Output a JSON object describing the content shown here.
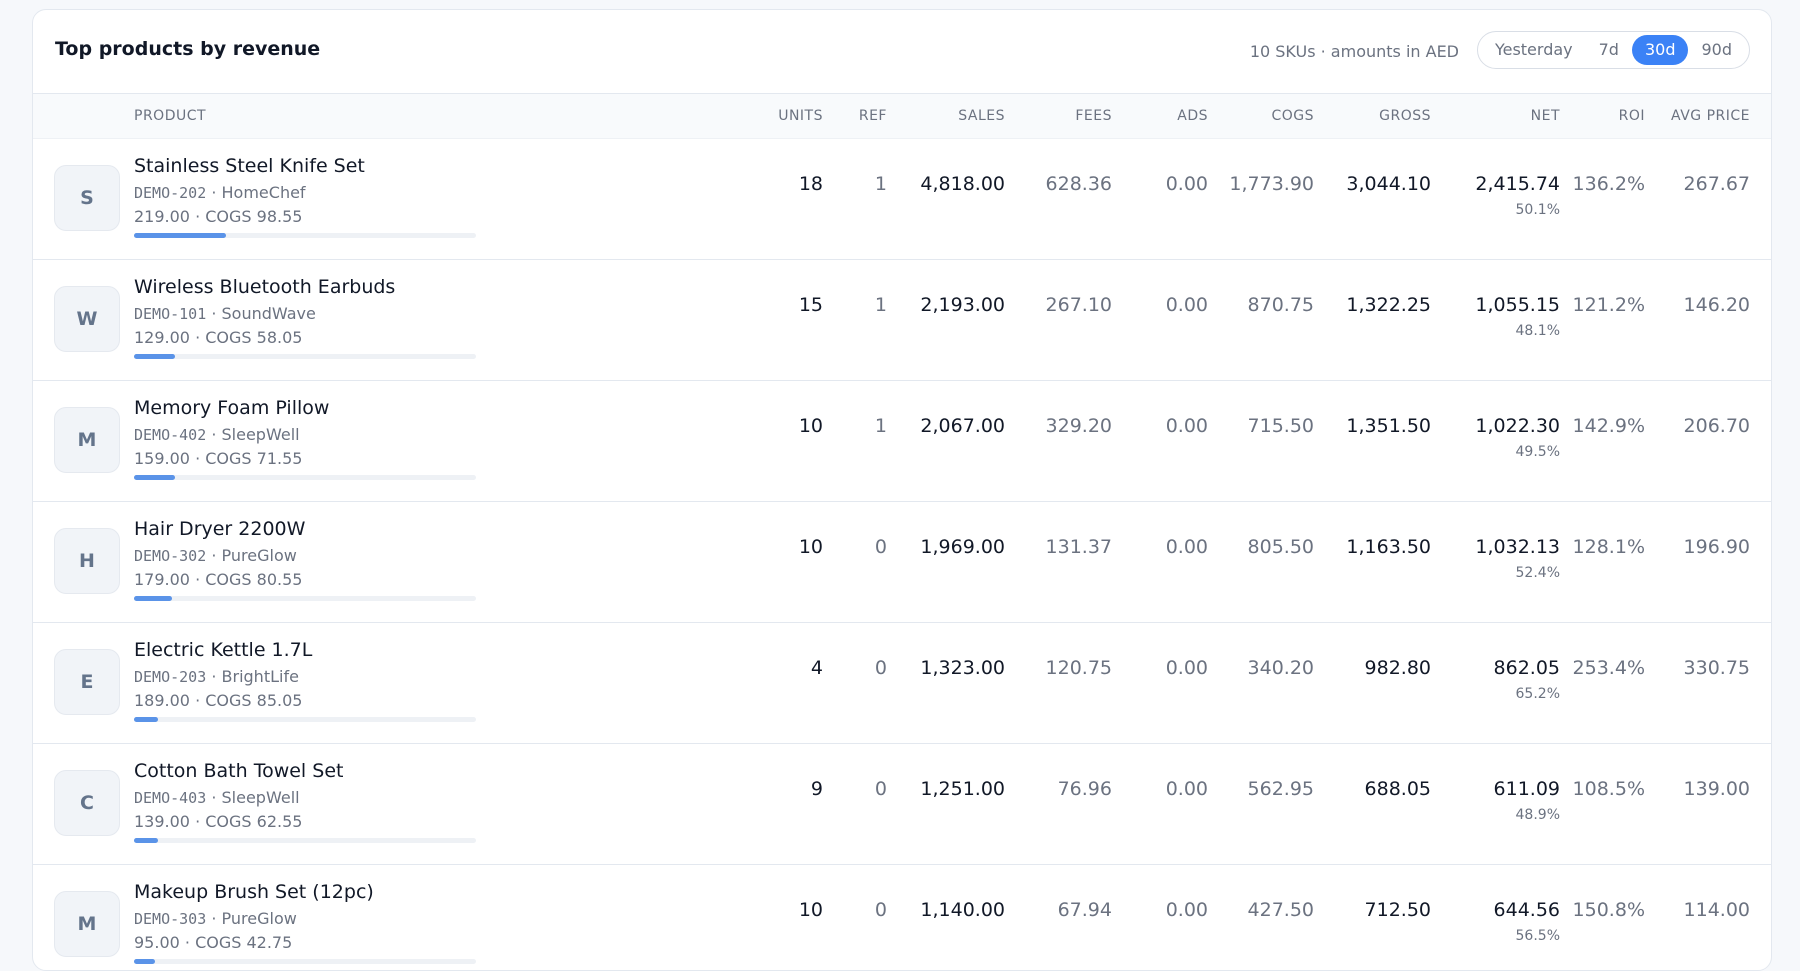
{
  "title": "Top products by revenue",
  "meta": "10 SKUs · amounts in AED",
  "ranges": [
    {
      "label": "Yesterday",
      "active": false
    },
    {
      "label": "7d",
      "active": false
    },
    {
      "label": "30d",
      "active": true
    },
    {
      "label": "90d",
      "active": false
    }
  ],
  "columns": {
    "product": "PRODUCT",
    "units": "UNITS",
    "ref": "REF",
    "sales": "SALES",
    "fees": "FEES",
    "ads": "ADS",
    "cogs": "COGS",
    "gross": "GROSS",
    "net": "NET",
    "roi": "ROI",
    "avg_price": "AVG PRICE"
  },
  "rows": [
    {
      "initial": "S",
      "name": "Stainless Steel Knife Set",
      "sku": "DEMO-202",
      "brand": "HomeChef",
      "price_line": "219.00 · COGS 98.55",
      "share": 0.27,
      "units": "18",
      "ref": "1",
      "sales": "4,818.00",
      "fees": "628.36",
      "ads": "0.00",
      "cogs": "1,773.90",
      "gross": "3,044.10",
      "net": "2,415.74",
      "margin": "50.1%",
      "roi": "136.2%",
      "avg_price": "267.67"
    },
    {
      "initial": "W",
      "name": "Wireless Bluetooth Earbuds",
      "sku": "DEMO-101",
      "brand": "SoundWave",
      "price_line": "129.00 · COGS 58.05",
      "share": 0.12,
      "units": "15",
      "ref": "1",
      "sales": "2,193.00",
      "fees": "267.10",
      "ads": "0.00",
      "cogs": "870.75",
      "gross": "1,322.25",
      "net": "1,055.15",
      "margin": "48.1%",
      "roi": "121.2%",
      "avg_price": "146.20"
    },
    {
      "initial": "M",
      "name": "Memory Foam Pillow",
      "sku": "DEMO-402",
      "brand": "SleepWell",
      "price_line": "159.00 · COGS 71.55",
      "share": 0.12,
      "units": "10",
      "ref": "1",
      "sales": "2,067.00",
      "fees": "329.20",
      "ads": "0.00",
      "cogs": "715.50",
      "gross": "1,351.50",
      "net": "1,022.30",
      "margin": "49.5%",
      "roi": "142.9%",
      "avg_price": "206.70"
    },
    {
      "initial": "H",
      "name": "Hair Dryer 2200W",
      "sku": "DEMO-302",
      "brand": "PureGlow",
      "price_line": "179.00 · COGS 80.55",
      "share": 0.11,
      "units": "10",
      "ref": "0",
      "sales": "1,969.00",
      "fees": "131.37",
      "ads": "0.00",
      "cogs": "805.50",
      "gross": "1,163.50",
      "net": "1,032.13",
      "margin": "52.4%",
      "roi": "128.1%",
      "avg_price": "196.90"
    },
    {
      "initial": "E",
      "name": "Electric Kettle 1.7L",
      "sku": "DEMO-203",
      "brand": "BrightLife",
      "price_line": "189.00 · COGS 85.05",
      "share": 0.07,
      "units": "4",
      "ref": "0",
      "sales": "1,323.00",
      "fees": "120.75",
      "ads": "0.00",
      "cogs": "340.20",
      "gross": "982.80",
      "net": "862.05",
      "margin": "65.2%",
      "roi": "253.4%",
      "avg_price": "330.75"
    },
    {
      "initial": "C",
      "name": "Cotton Bath Towel Set",
      "sku": "DEMO-403",
      "brand": "SleepWell",
      "price_line": "139.00 · COGS 62.55",
      "share": 0.07,
      "units": "9",
      "ref": "0",
      "sales": "1,251.00",
      "fees": "76.96",
      "ads": "0.00",
      "cogs": "562.95",
      "gross": "688.05",
      "net": "611.09",
      "margin": "48.9%",
      "roi": "108.5%",
      "avg_price": "139.00"
    },
    {
      "initial": "M",
      "name": "Makeup Brush Set (12pc)",
      "sku": "DEMO-303",
      "brand": "PureGlow",
      "price_line": "95.00 · COGS 42.75",
      "share": 0.06,
      "units": "10",
      "ref": "0",
      "sales": "1,140.00",
      "fees": "67.94",
      "ads": "0.00",
      "cogs": "427.50",
      "gross": "712.50",
      "net": "644.56",
      "margin": "56.5%",
      "roi": "150.8%",
      "avg_price": "114.00"
    }
  ],
  "colors": {
    "accent": "#3b82f6",
    "bar": "#5a93e8",
    "muted": "#6b7280",
    "text": "#111827"
  }
}
